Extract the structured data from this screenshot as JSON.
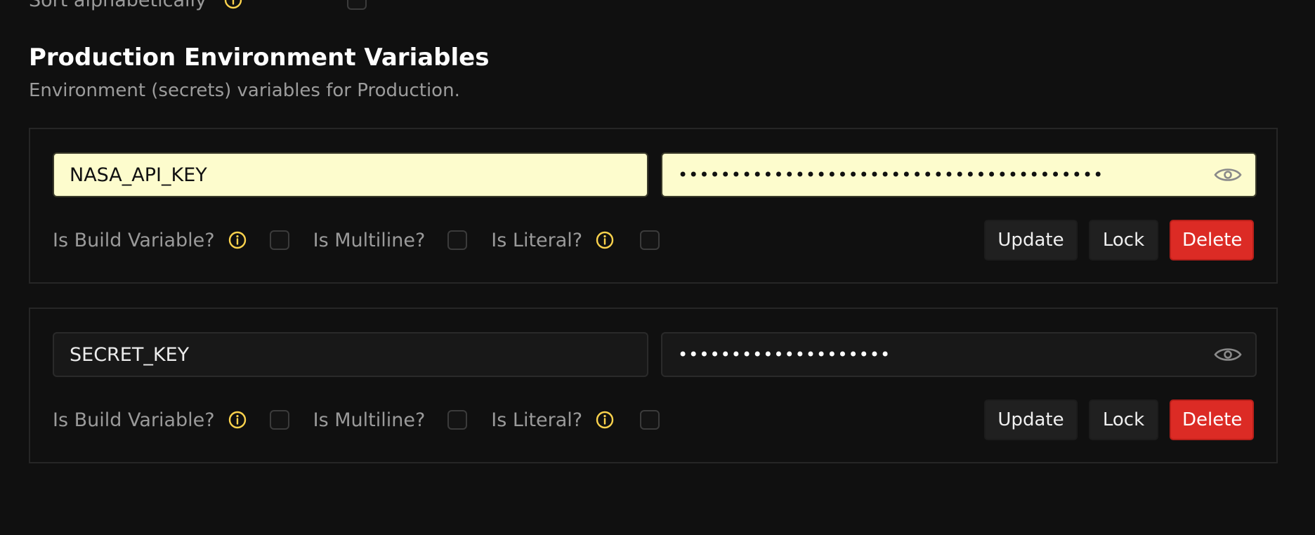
{
  "top_partial": {
    "label": "Sort alphabetically"
  },
  "section": {
    "title": "Production Environment Variables",
    "description": "Environment (secrets) variables for Production."
  },
  "variables": [
    {
      "key": "NASA_API_KEY",
      "masked_value": "••••••••••••••••••••••••••••••••••••••••",
      "autofilled": true,
      "is_build_label": "Is Build Variable?",
      "is_multiline_label": "Is Multiline?",
      "is_literal_label": "Is Literal?",
      "is_build_checked": false,
      "is_multiline_checked": false,
      "is_literal_checked": false,
      "update_label": "Update",
      "lock_label": "Lock",
      "delete_label": "Delete"
    },
    {
      "key": "SECRET_KEY",
      "masked_value": "••••••••••••••••••••",
      "autofilled": false,
      "is_build_label": "Is Build Variable?",
      "is_multiline_label": "Is Multiline?",
      "is_literal_label": "Is Literal?",
      "is_build_checked": false,
      "is_multiline_checked": false,
      "is_literal_checked": false,
      "update_label": "Update",
      "lock_label": "Lock",
      "delete_label": "Delete"
    }
  ],
  "icons": {
    "info": "info-icon",
    "reveal": "eye-icon"
  },
  "colors": {
    "background": "#101010",
    "autofill": "#fdfccd",
    "info_accent": "#fcd34d",
    "delete": "#dc2b25"
  }
}
